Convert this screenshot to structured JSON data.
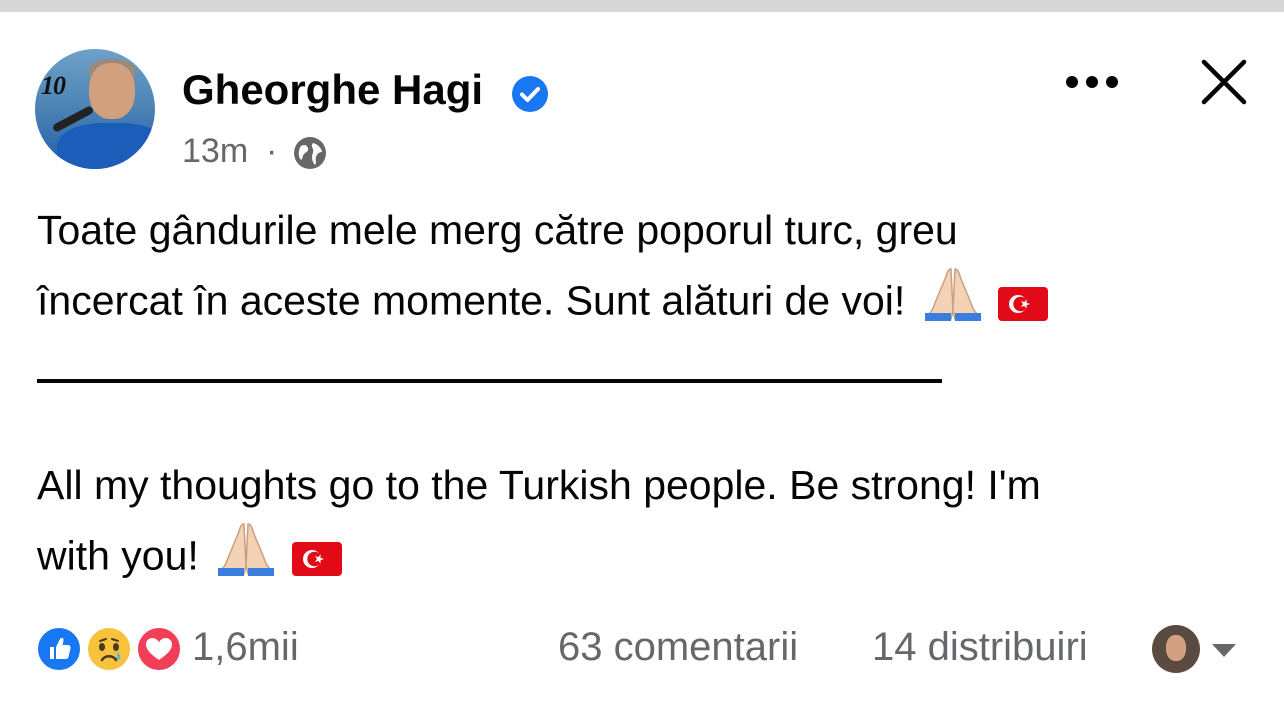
{
  "post": {
    "author": {
      "name": "Gheorghe Hagi",
      "verified": true,
      "avatar_jersey_number": "10"
    },
    "meta": {
      "time": "13m",
      "separator": "·",
      "audience_icon": "globe-icon"
    },
    "header_actions": {
      "more_icon": "more-horizontal-icon",
      "close_icon": "close-icon"
    },
    "text": {
      "ro_line_1": "Toate gândurile mele merg către poporul turc, greu",
      "ro_line_2": "încercat în aceste momente. Sunt alături de voi!",
      "separator": "_________________________________________",
      "en_line_1": "All my thoughts go to the Turkish people. Be strong! I'm",
      "en_line_2": "with you!",
      "emoji": [
        "folded-hands",
        "turkey-flag"
      ]
    },
    "footer": {
      "reactions": [
        "like",
        "sad",
        "love"
      ],
      "reaction_count": "1,6mii",
      "comments": "63 comentarii",
      "shares": "14 distribuiri",
      "viewer_menu_icon": "chevron-down-icon"
    },
    "colors": {
      "primary_text": "#050505",
      "secondary_text": "#65676b",
      "facebook_blue": "#1877f2",
      "love_red": "#f33e58",
      "sad_yellow": "#f7c33d",
      "turkey_red": "#e30a17"
    }
  }
}
